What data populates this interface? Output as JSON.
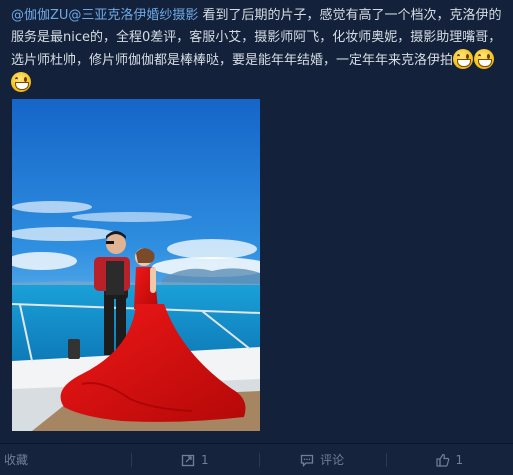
{
  "post": {
    "mention": "@伽伽ZU@三亚克洛伊婚纱摄影",
    "body": " 看到了后期的片子，感觉有高了一个档次，克洛伊的服务是最nice的，全程0差评，客服小艾，摄影师阿飞，化妆师奥妮，摄影助理嘴哥，选片师杜帅，修片师伽伽都是棒棒哒，要是能年年结婚，一定年年来克洛伊拍",
    "emoji_name": "grin-emoji",
    "emoji_count": 3
  },
  "photo": {
    "description_icon": "wedding-photo-boat"
  },
  "actions": {
    "favorite_label": "收藏",
    "repost_count": "1",
    "comment_label": "评论",
    "like_count": "1"
  },
  "colors": {
    "background": "#13223a",
    "link": "#6fa8e6",
    "muted": "#6f7f95"
  }
}
